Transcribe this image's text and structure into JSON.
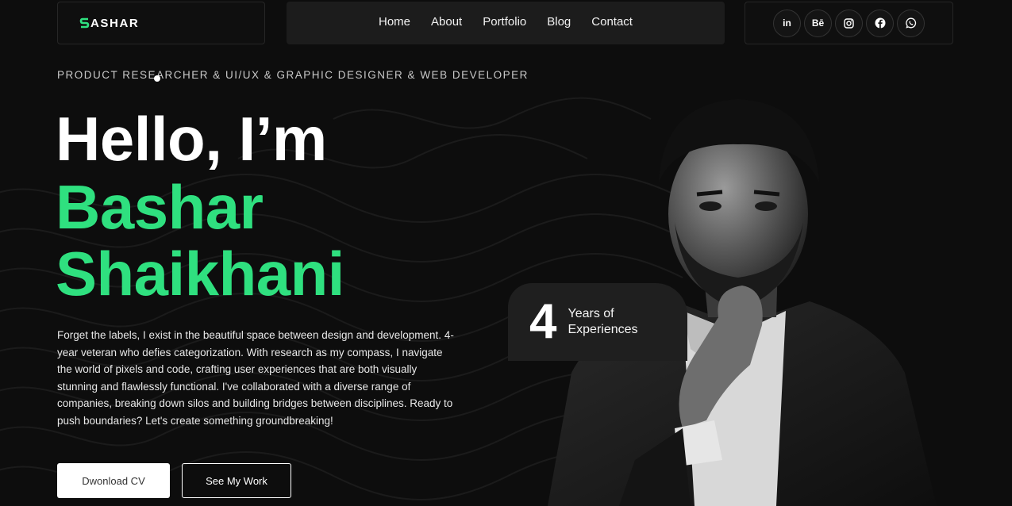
{
  "brand": {
    "logo_text": "ASHAR",
    "logo_mark_color": "#2fe07f"
  },
  "nav": {
    "items": [
      {
        "label": "Home"
      },
      {
        "label": "About"
      },
      {
        "label": "Portfolio"
      },
      {
        "label": "Blog"
      },
      {
        "label": "Contact"
      }
    ]
  },
  "social": [
    {
      "icon": "linkedin-icon",
      "glyph": "in"
    },
    {
      "icon": "behance-icon",
      "glyph": "Bē"
    },
    {
      "icon": "instagram-icon",
      "glyph": ""
    },
    {
      "icon": "facebook-icon",
      "glyph": ""
    },
    {
      "icon": "whatsapp-icon",
      "glyph": ""
    }
  ],
  "hero": {
    "tagline": "PRODUCT RESEARCHER & UI/UX & GRAPHIC DESIGNER & WEB DEVELOPER",
    "greeting": "Hello, I’m",
    "first_name": "Bashar",
    "last_name": "Shaikhani",
    "bio": "Forget the labels, I exist in the beautiful space between design and development. 4-year veteran who defies categorization. With research as my compass, I navigate the world of pixels and code, crafting user experiences that are both visually stunning and flawlessly functional. I've collaborated with a diverse range of companies, breaking down silos and building bridges between disciplines. Ready to push boundaries? Let's create something groundbreaking!",
    "download_button": "Dwonload CV",
    "work_button": "See My Work"
  },
  "experience": {
    "number": "4",
    "label": "Years of Experiences"
  },
  "colors": {
    "accent": "#2fe07f",
    "background": "#0d0d0d"
  }
}
